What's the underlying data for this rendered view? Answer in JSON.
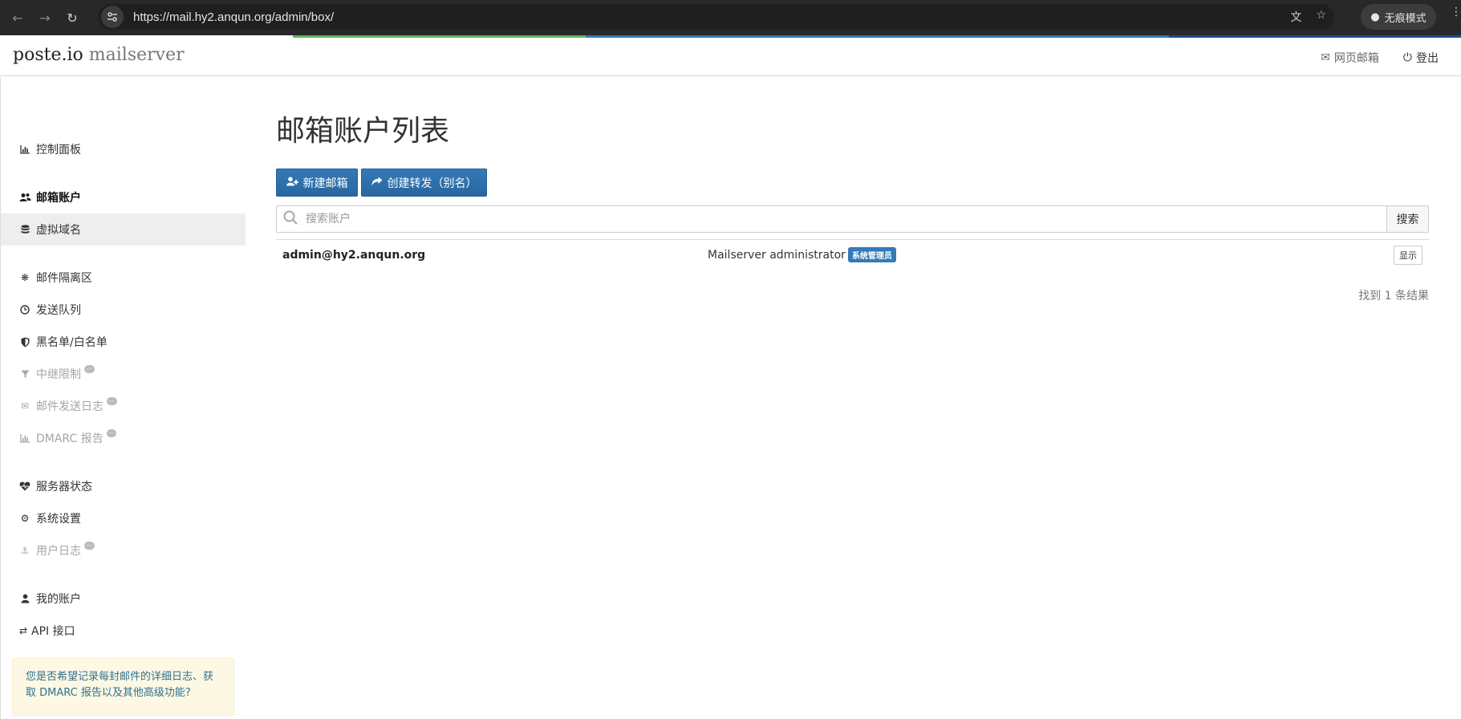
{
  "browser": {
    "url": "https://mail.hy2.anqun.org/admin/box/",
    "incognito_label": "无痕模式"
  },
  "navbar": {
    "brand_main": "poste.io",
    "brand_sub": "mailserver",
    "webmail_label": "网页邮箱",
    "logout_label": "登出"
  },
  "sidebar": {
    "items": [
      {
        "label": "控制面板",
        "icon": "bar-chart-icon"
      },
      {
        "label": "邮箱账户",
        "icon": "users-icon"
      },
      {
        "label": "虚拟域名",
        "icon": "database-icon"
      },
      {
        "label": "邮件隔离区",
        "icon": "bug-icon"
      },
      {
        "label": "发送队列",
        "icon": "clock-icon"
      },
      {
        "label": "黑名单/白名单",
        "icon": "shield-icon"
      },
      {
        "label": "中继限制",
        "icon": "filter-icon"
      },
      {
        "label": "邮件发送日志",
        "icon": "envelope-icon"
      },
      {
        "label": "DMARC 报告",
        "icon": "bar-chart-icon"
      },
      {
        "label": "服务器状态",
        "icon": "heartbeat-icon"
      },
      {
        "label": "系统设置",
        "icon": "gears-icon"
      },
      {
        "label": "用户日志",
        "icon": "user-log-icon"
      },
      {
        "label": "我的账户",
        "icon": "user-icon"
      },
      {
        "label": "API 接口",
        "icon": "exchange-icon"
      }
    ],
    "promo_text": "您是否希望记录每封邮件的详细日志、获取 DMARC 报告以及其他高级功能?"
  },
  "main": {
    "title": "邮箱账户列表",
    "new_mailbox_label": "新建邮箱",
    "create_alias_label": "创建转发（别名）",
    "search_placeholder": "搜索账户",
    "search_button": "搜索",
    "accounts": [
      {
        "email": "admin@hy2.anqun.org",
        "name": "Mailserver administrator",
        "role_badge": "系统管理员",
        "show_label": "显示"
      }
    ],
    "result_count": "找到 1 条结果"
  }
}
